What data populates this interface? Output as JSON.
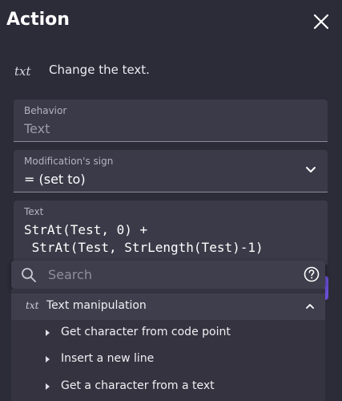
{
  "header": {
    "title": "Action",
    "close_icon": "close-icon"
  },
  "action": {
    "icon_text": "txt",
    "description": "Change the text."
  },
  "fields": {
    "behavior": {
      "label": "Behavior",
      "value": "Text"
    },
    "modification_sign": {
      "label": "Modification's sign",
      "value": "= (set to)"
    },
    "text": {
      "label": "Text",
      "line1": "StrAt(Test, 0) +",
      "line2": " StrAt(Test, StrLength(Test)-1)"
    }
  },
  "search": {
    "placeholder": "Search",
    "icon": "search-icon",
    "help_icon": "help-icon"
  },
  "list": {
    "category": {
      "icon_text": "txt",
      "label": "Text manipulation"
    },
    "items": [
      {
        "label": "Get character from code point"
      },
      {
        "label": "Insert a new line"
      },
      {
        "label": "Get a character from a text"
      }
    ]
  },
  "colors": {
    "background": "#2c2b38",
    "field": "#3b3a48",
    "accent": "#6a4fd6"
  }
}
